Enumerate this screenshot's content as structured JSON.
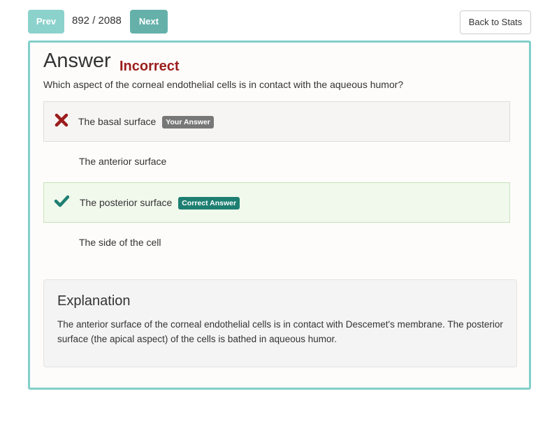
{
  "nav": {
    "prev_label": "Prev",
    "counter": "892 / 2088",
    "next_label": "Next",
    "back_label": "Back to Stats"
  },
  "answer": {
    "heading": "Answer",
    "result": "Incorrect",
    "question": "Which aspect of the corneal endothelial cells is in contact with the aqueous humor?",
    "options": [
      {
        "label": "The basal surface",
        "badge": "Your Answer",
        "state": "wrong",
        "icon": "x-icon"
      },
      {
        "label": "The anterior surface",
        "badge": "",
        "state": "none",
        "icon": ""
      },
      {
        "label": "The posterior surface",
        "badge": "Correct Answer",
        "state": "correct",
        "icon": "check-icon"
      },
      {
        "label": "The side of the cell",
        "badge": "",
        "state": "none",
        "icon": ""
      }
    ]
  },
  "explanation": {
    "title": "Explanation",
    "text": "The anterior surface of the corneal endothelial cells is in contact with Descemet's membrane. The posterior surface (the apical aspect) of the cells is bathed in aqueous humor."
  },
  "colors": {
    "accent": "#82cfc9",
    "incorrect": "#9c1c1c",
    "correct": "#1d7f72",
    "your_answer_badge": "#777777"
  }
}
